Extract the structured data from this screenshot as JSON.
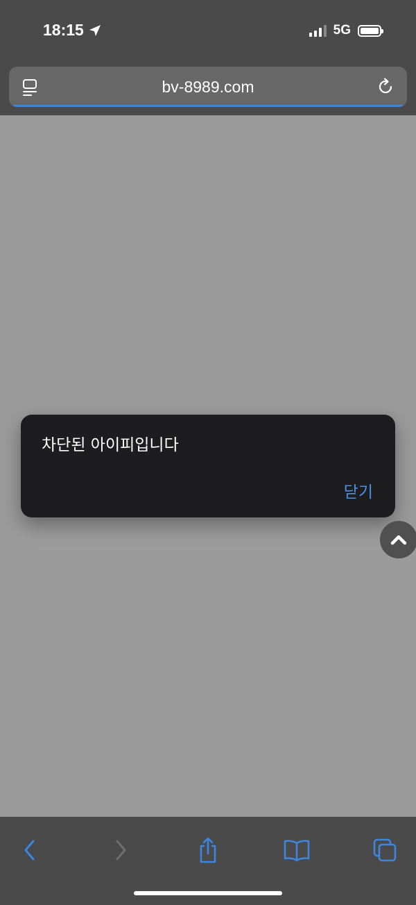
{
  "status_bar": {
    "time": "18:15",
    "network": "5G"
  },
  "browser": {
    "url": "bv-8989.com",
    "load_progress": 1.0
  },
  "alert": {
    "message": "차단된 아이피입니다",
    "button_label": "닫기"
  },
  "icons": {
    "reader": "reader-mode-icon",
    "reload": "reload-icon",
    "scroll_top": "chevron-up-icon",
    "back": "chevron-left-icon",
    "forward": "chevron-right-icon",
    "share": "share-icon",
    "bookmarks": "book-icon",
    "tabs": "tabs-icon"
  },
  "colors": {
    "accent": "#3d86e0",
    "page_background": "#9b9b9b",
    "chrome_background": "#4a4a4a",
    "alert_background": "#1d1d1f"
  }
}
